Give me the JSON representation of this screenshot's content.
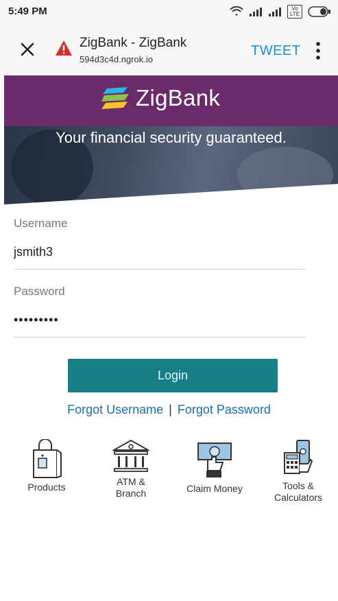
{
  "status_bar": {
    "time": "5:49 PM",
    "network_badge": "Vo LTE"
  },
  "browser": {
    "title": "ZigBank - ZigBank",
    "url": "594d3c4d.ngrok.io",
    "tweet_label": "TWEET"
  },
  "brand": {
    "name": "ZigBank",
    "tagline": "Your financial security guaranteed."
  },
  "form": {
    "username_label": "Username",
    "username_value": "jsmith3",
    "password_label": "Password",
    "password_value": "•••••••••",
    "login_label": "Login",
    "forgot_username": "Forgot Username",
    "separator": "|",
    "forgot_password": "Forgot Password"
  },
  "quick_links": [
    {
      "label": "Products",
      "icon": "shopping-bag-icon"
    },
    {
      "label": "ATM &\nBranch",
      "icon": "bank-building-icon"
    },
    {
      "label": "Claim Money",
      "icon": "cash-hand-icon"
    },
    {
      "label": "Tools &\nCalculators",
      "icon": "calculator-phone-icon"
    }
  ],
  "colors": {
    "brand_purple": "#6b2a6b",
    "button_teal": "#167f88",
    "link_blue": "#1a6fb3",
    "tweet_blue": "#1a8fe0"
  }
}
